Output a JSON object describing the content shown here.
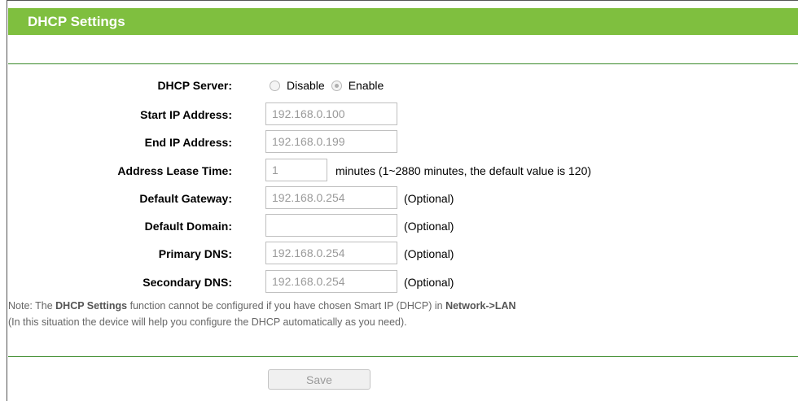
{
  "header": {
    "title": "DHCP Settings"
  },
  "form": {
    "dhcp_server": {
      "label": "DHCP Server:",
      "options": [
        {
          "label": "Disable",
          "selected": false
        },
        {
          "label": "Enable",
          "selected": true
        }
      ]
    },
    "start_ip": {
      "label": "Start IP Address:",
      "value": "192.168.0.100"
    },
    "end_ip": {
      "label": "End IP Address:",
      "value": "192.168.0.199"
    },
    "lease_time": {
      "label": "Address Lease Time:",
      "value": "1",
      "suffix": "minutes (1~2880 minutes, the default value is 120)"
    },
    "default_gateway": {
      "label": "Default Gateway:",
      "value": "192.168.0.254",
      "suffix": "(Optional)"
    },
    "default_domain": {
      "label": "Default Domain:",
      "value": "",
      "suffix": "(Optional)"
    },
    "primary_dns": {
      "label": "Primary DNS:",
      "value": "192.168.0.254",
      "suffix": "(Optional)"
    },
    "secondary_dns": {
      "label": "Secondary DNS:",
      "value": "192.168.0.254",
      "suffix": "(Optional)"
    }
  },
  "note": {
    "prefix": "Note: The ",
    "bold1": "DHCP Settings",
    "middle": " function cannot be configured if you have chosen Smart IP (DHCP) in ",
    "bold2": "Network->LAN",
    "line2": "(In this situation the device will help you configure the DHCP automatically as you need)."
  },
  "actions": {
    "save_label": "Save"
  },
  "colors": {
    "header_bg": "#7fbf3f",
    "divider": "#3a8a2a"
  }
}
